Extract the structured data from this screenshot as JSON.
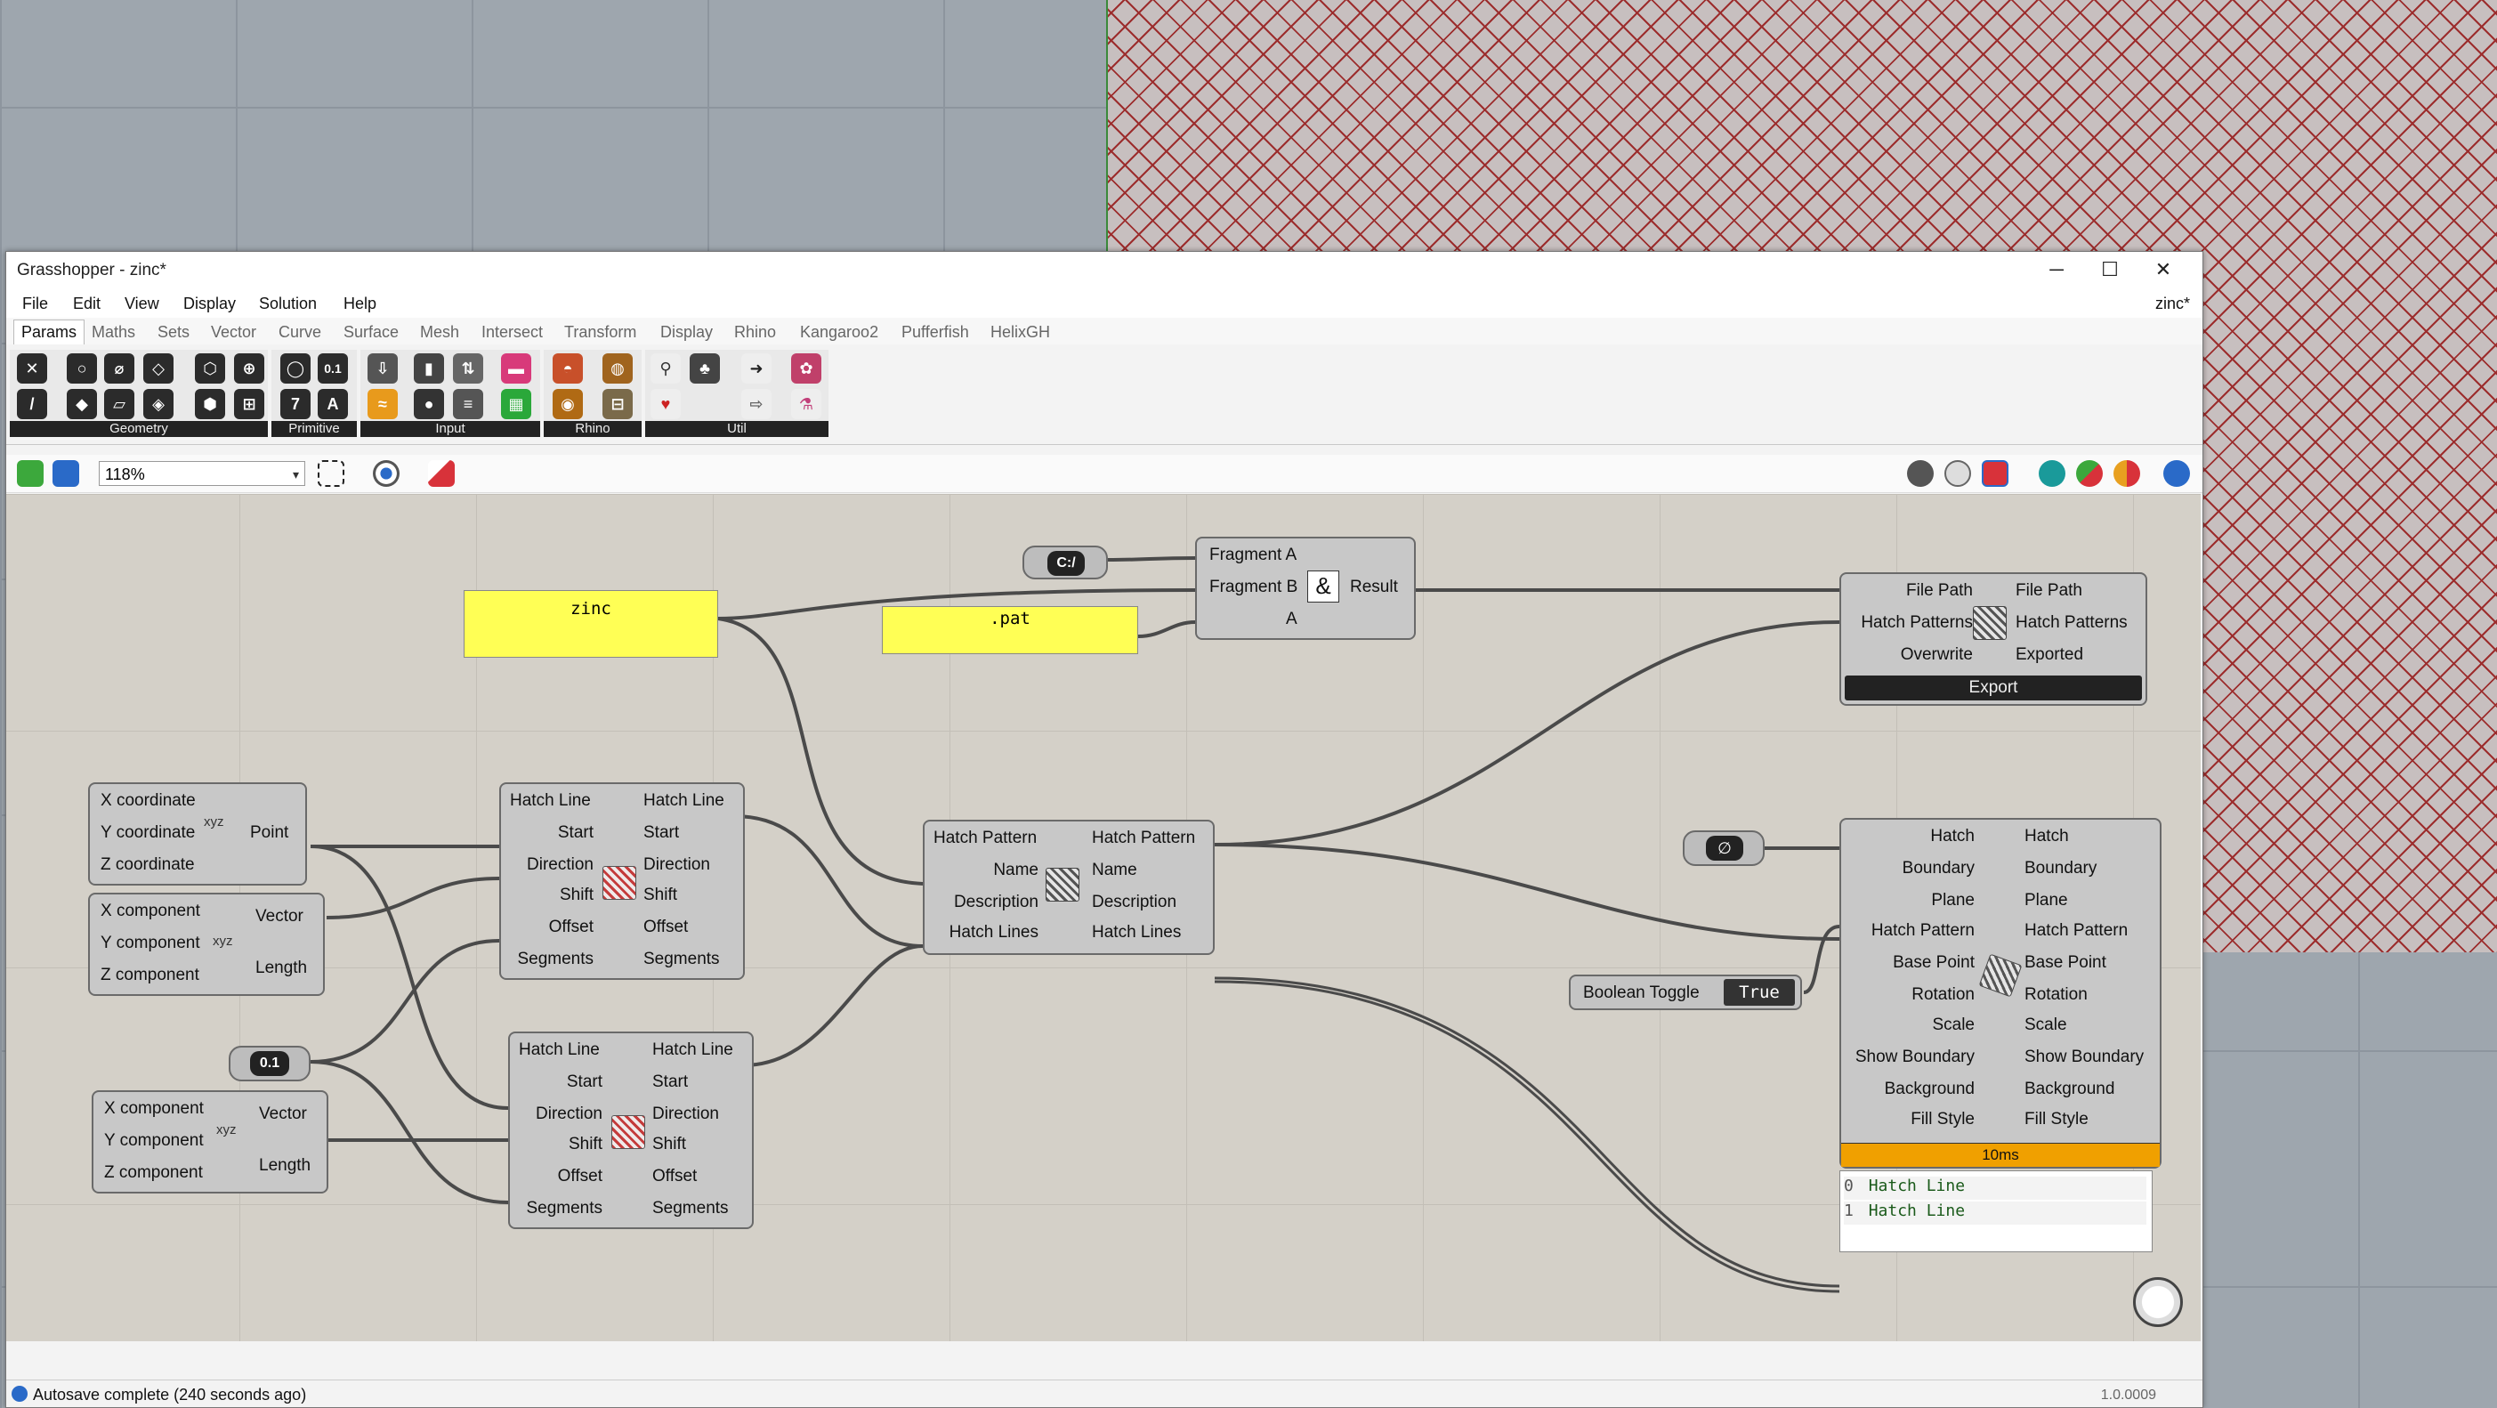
{
  "window": {
    "title": "Grasshopper - zinc*",
    "doc_name": "zinc*",
    "min": "─",
    "max": "☐",
    "close": "✕"
  },
  "menu": [
    "File",
    "Edit",
    "View",
    "Display",
    "Solution",
    "Help"
  ],
  "tabs": [
    "Params",
    "Maths",
    "Sets",
    "Vector",
    "Curve",
    "Surface",
    "Mesh",
    "Intersect",
    "Transform",
    "Display",
    "Rhino",
    "Kangaroo2",
    "Pufferfish",
    "HelixGH"
  ],
  "ribbon_groups": [
    "Geometry",
    "Primitive",
    "Input",
    "Rhino",
    "Util"
  ],
  "zoom": "118%",
  "status": "Autosave complete (240 seconds ago)",
  "version": "1.0.0009",
  "colors": {
    "canvas": "#d4d0c8",
    "panel": "#ffff55",
    "profiler": "#f0a000",
    "hatch_preview": "#9c2d2d"
  },
  "nodes": {
    "path_sep": "C:/",
    "panel_zinc": "zinc",
    "panel_pat": ".pat",
    "concat": {
      "in": [
        "Fragment A",
        "Fragment B",
        "A"
      ],
      "out": "Result",
      "icon": "&"
    },
    "export": {
      "in": [
        "File Path",
        "Hatch Patterns",
        "Overwrite"
      ],
      "out": [
        "File Path",
        "Hatch Patterns",
        "Exported"
      ],
      "button": "Export"
    },
    "toggle": {
      "label": "Boolean Toggle",
      "value": "True"
    },
    "construct_point": {
      "in": [
        "X coordinate",
        "Y coordinate",
        "Z coordinate"
      ],
      "out": "Point"
    },
    "vector1": {
      "in": [
        "X component",
        "Y component",
        "Z component"
      ],
      "out": [
        "Vector",
        "Length"
      ]
    },
    "vector2": {
      "in": [
        "X component",
        "Y component",
        "Z component"
      ],
      "out": [
        "Vector",
        "Length"
      ]
    },
    "number": "0.1",
    "hatch_line": [
      "Hatch Line",
      "Start",
      "Direction",
      "Shift",
      "Offset",
      "Segments"
    ],
    "hatch_pattern": [
      "Hatch Pattern",
      "Name",
      "Description",
      "Hatch Lines"
    ],
    "hatch": [
      "Hatch",
      "Boundary",
      "Plane",
      "Hatch Pattern",
      "Base Point",
      "Rotation",
      "Scale",
      "Show Boundary",
      "Background",
      "Fill Style"
    ],
    "profiler": "10ms",
    "data_list": [
      "0",
      "Hatch Line",
      "1",
      "Hatch Line"
    ]
  }
}
